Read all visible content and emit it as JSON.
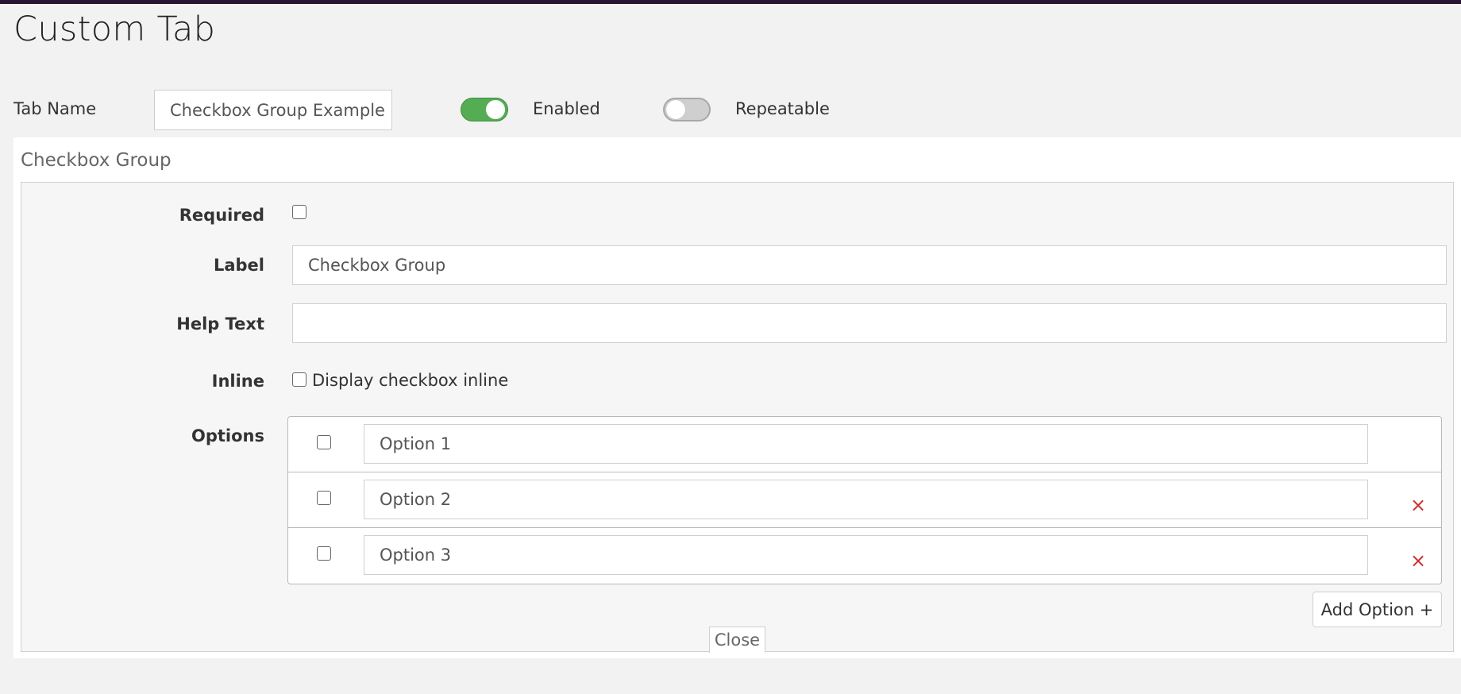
{
  "page": {
    "title": "Custom Tab"
  },
  "tab_settings": {
    "tab_name_label": "Tab Name",
    "tab_name_value": "Checkbox Group Example",
    "enabled_label": "Enabled",
    "enabled": true,
    "repeatable_label": "Repeatable",
    "repeatable": false
  },
  "field": {
    "title": "Checkbox Group",
    "required_label": "Required",
    "required": false,
    "label_label": "Label",
    "label_value": "Checkbox Group",
    "help_text_label": "Help Text",
    "help_text_value": "",
    "inline_label": "Inline",
    "inline_checkbox_text": "Display checkbox inline",
    "inline": false,
    "options_label": "Options",
    "options": [
      {
        "value": "Option 1",
        "checked": false,
        "removable": false
      },
      {
        "value": "Option 2",
        "checked": false,
        "removable": true
      },
      {
        "value": "Option 3",
        "checked": false,
        "removable": true
      }
    ],
    "remove_symbol": "×",
    "add_option_label": "Add Option +",
    "close_label": "Close"
  },
  "colors": {
    "toggle_on": "#55ad53",
    "toggle_off": "#cfcfcf",
    "remove": "#c9302c",
    "topbar": "#2a1433"
  }
}
